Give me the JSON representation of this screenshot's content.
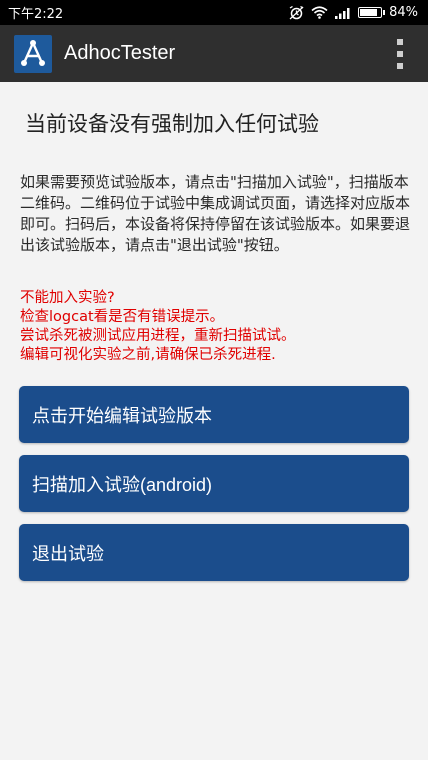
{
  "status_bar": {
    "time": "下午2:22",
    "battery_text": "84%",
    "battery_level": 0.84,
    "icons": [
      "alarm-icon",
      "wifi-icon",
      "signal-icon",
      "battery-icon"
    ]
  },
  "app_bar": {
    "title": "AdhocTester",
    "logo_icon": "adhoc-logo-icon",
    "menu_icon": "overflow-menu-icon"
  },
  "main": {
    "headline": "当前设备没有强制加入任何试验",
    "description": "如果需要预览试验版本，请点击\"扫描加入试验\"，扫描版本二维码。二维码位于试验中集成调试页面，请选择对应版本即可。扫码后，本设备将保持停留在该试验版本。如果要退出该试验版本，请点击\"退出试验\"按钮。",
    "error_lines": [
      "不能加入实验?",
      "检查logcat看是否有错误提示。",
      "尝试杀死被测试应用进程，重新扫描试试。",
      "编辑可视化实验之前,请确保已杀死进程."
    ],
    "buttons": {
      "edit": "点击开始编辑试验版本",
      "scan": "扫描加入试验(android)",
      "exit": "退出试验"
    }
  },
  "colors": {
    "app_bar": "#2f2f2f",
    "button": "#1b4d8c",
    "error_text": "#e00000",
    "background": "#f3f3f3"
  }
}
